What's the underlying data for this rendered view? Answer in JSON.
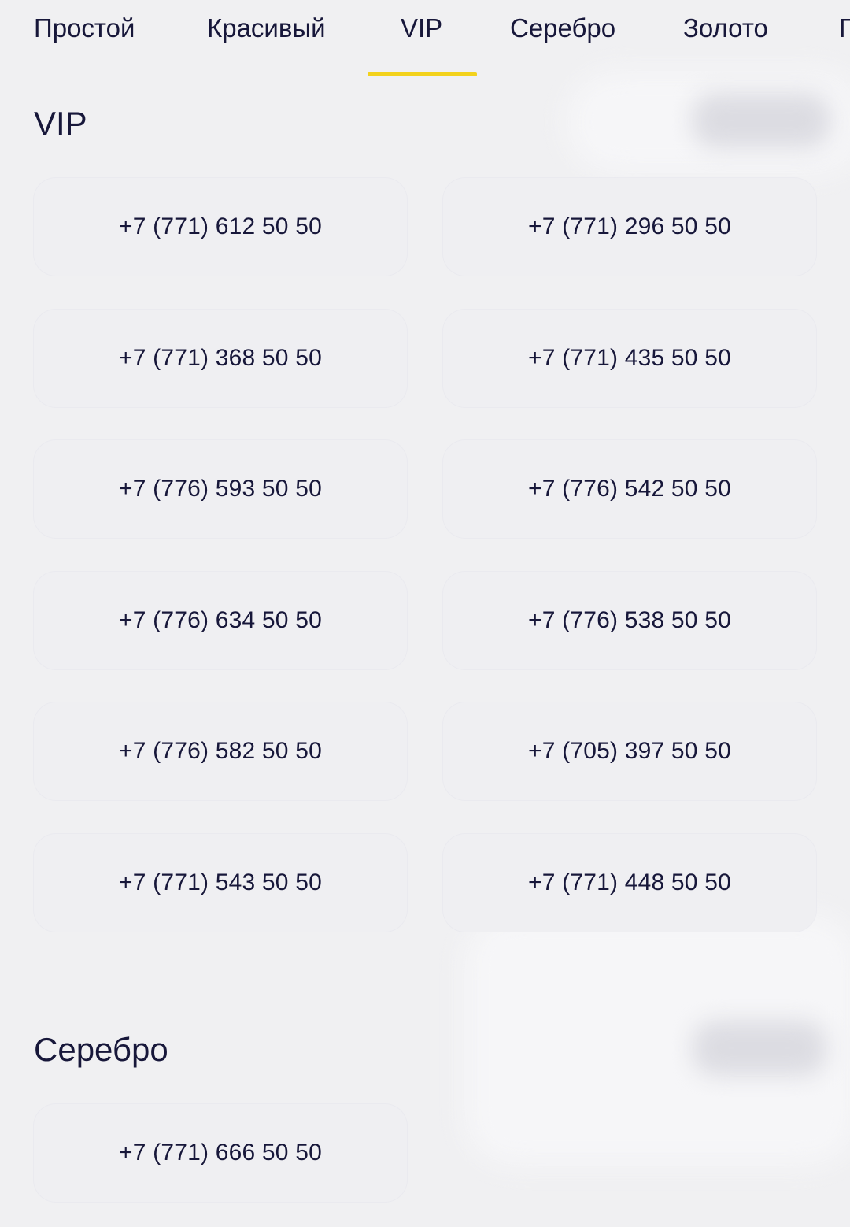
{
  "tabs": [
    {
      "label": "Простой"
    },
    {
      "label": "Красивый"
    },
    {
      "label": "VIP",
      "active": true
    },
    {
      "label": "Серебро"
    },
    {
      "label": "Золото"
    },
    {
      "label": "Г"
    }
  ],
  "accent_color": "#f3d21c",
  "sections": {
    "vip": {
      "title": "VIP",
      "numbers": [
        "+7 (771) 612 50 50",
        "+7 (771) 296 50 50",
        "+7 (771) 368 50 50",
        "+7 (771) 435 50 50",
        "+7 (776) 593 50 50",
        "+7 (776) 542 50 50",
        "+7 (776) 634 50 50",
        "+7 (776) 538 50 50",
        "+7 (776) 582 50 50",
        "+7 (705) 397 50 50",
        "+7 (771) 543 50 50",
        "+7 (771) 448 50 50"
      ]
    },
    "silver": {
      "title": "Серебро",
      "numbers": [
        "+7 (771) 666 50 50"
      ]
    }
  }
}
